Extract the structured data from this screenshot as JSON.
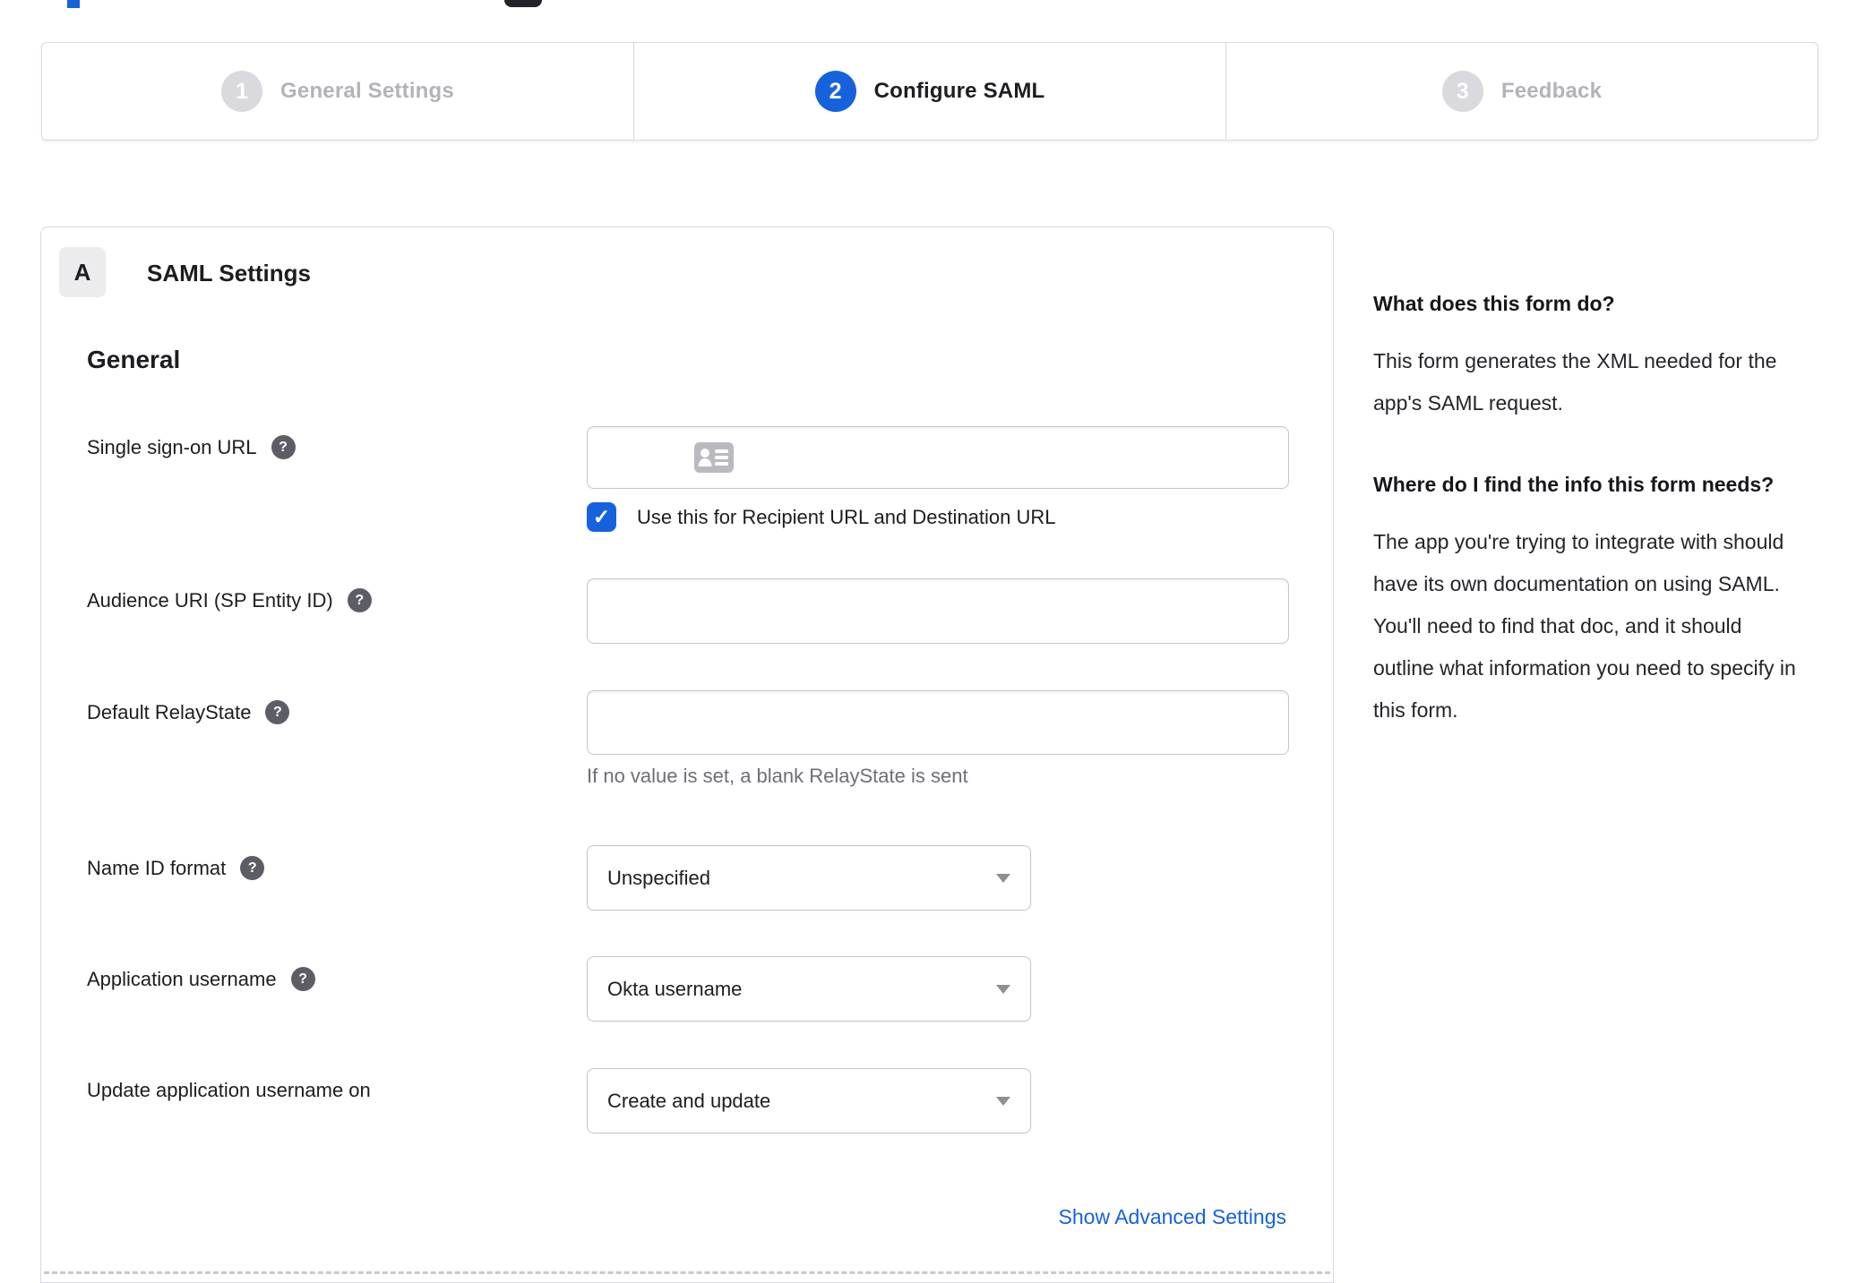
{
  "colors": {
    "accent_blue": "#1662dd",
    "inactive_gray": "#d9d9de",
    "border_gray": "#c6c6cb",
    "hint_gray": "#6e6e78"
  },
  "icons": {
    "help": "?",
    "check": "✓",
    "dropdown_arrow": "▾",
    "contact_card": "contact-card"
  },
  "stepper": {
    "steps": [
      {
        "number": "1",
        "label": "General Settings",
        "state": "inactive"
      },
      {
        "number": "2",
        "label": "Configure SAML",
        "state": "active"
      },
      {
        "number": "3",
        "label": "Feedback",
        "state": "inactive"
      }
    ]
  },
  "panel": {
    "badge": "A",
    "title": "SAML Settings",
    "section_heading": "General",
    "fields": {
      "sso": {
        "label": "Single sign-on URL",
        "value": ""
      },
      "sso_checkbox": {
        "label": "Use this for Recipient URL and Destination URL",
        "checked": true
      },
      "audience": {
        "label": "Audience URI (SP Entity ID)",
        "value": ""
      },
      "relay": {
        "label": "Default RelayState",
        "value": "",
        "hint": "If no value is set, a blank RelayState is sent"
      },
      "name_id": {
        "label": "Name ID format",
        "value": "Unspecified"
      },
      "app_username": {
        "label": "Application username",
        "value": "Okta username"
      },
      "update_username": {
        "label": "Update application username on",
        "value": "Create and update"
      }
    },
    "advanced_link": "Show Advanced Settings"
  },
  "sidebar": {
    "sections": [
      {
        "heading": "What does this form do?",
        "body": "This form generates the XML needed for the app's SAML request."
      },
      {
        "heading": "Where do I find the info this form needs?",
        "body": "The app you're trying to integrate with should have its own documentation on using SAML. You'll need to find that doc, and it should outline what information you need to specify in this form."
      }
    ]
  }
}
